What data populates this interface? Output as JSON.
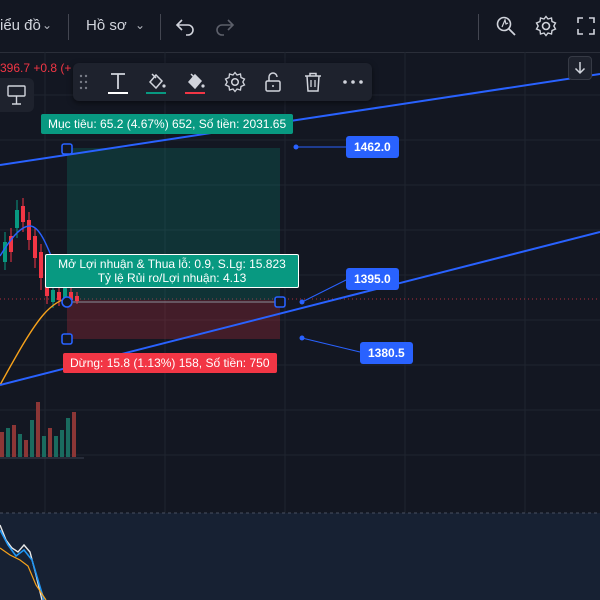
{
  "topbar": {
    "chart_menu_label": "iểu đồ",
    "profile_menu_label": "Hồ sơ"
  },
  "ticker": {
    "price_change": "396.7 +0.8 (+"
  },
  "position_tool": {
    "target_label": "Mục tiêu: 65.2 (4.67%) 652, Số tiền: 2031.65",
    "stop_label": "Dừng: 15.8 (1.13%) 158, Số tiền: 750",
    "pnl_line1": "Mở Lợi nhuận & Thua lỗ: 0.9, S.Lg: 15.823",
    "pnl_line2": "Tỷ lệ Rủi ro/Lợi nhuận: 4.13"
  },
  "price_levels": {
    "target": "1462.0",
    "entry": "1395.0",
    "stop": "1380.5"
  },
  "colors": {
    "background": "#131722",
    "profit": "#089981",
    "loss": "#f23645",
    "accent_blue": "#2962ff",
    "ma_line": "#f7a21b"
  },
  "icons": {
    "toolbar": [
      "drag-handle-icon",
      "text-icon",
      "fill-color-icon",
      "bg-color-icon",
      "settings-icon",
      "unlock-icon",
      "trash-icon",
      "more-icon"
    ],
    "topbar": [
      "undo-icon",
      "redo-icon",
      "quick-search-icon",
      "settings-icon",
      "fullscreen-icon"
    ]
  }
}
